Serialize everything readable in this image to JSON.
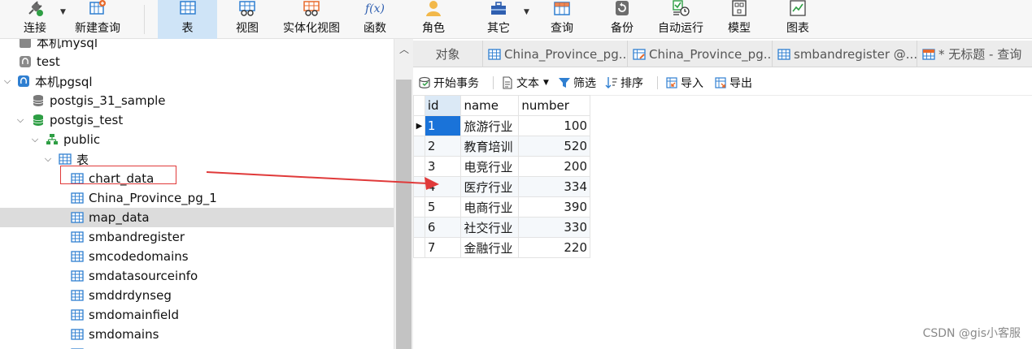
{
  "toolbar": {
    "connect": "连接",
    "new_query": "新建查询",
    "table": "表",
    "view": "视图",
    "materialized_view": "实体化视图",
    "function": "函数",
    "role": "角色",
    "other": "其它",
    "query": "查询",
    "backup": "备份",
    "automation": "自动运行",
    "model": "模型",
    "chart": "图表",
    "function_glyph": "f(x)"
  },
  "tree": {
    "partial_top": "本机mysql",
    "items": [
      {
        "label": "test"
      },
      {
        "label": "本机pgsql"
      },
      {
        "label": "postgis_31_sample"
      },
      {
        "label": "postgis_test"
      },
      {
        "label": "public"
      },
      {
        "label": "表"
      },
      {
        "label": "chart_data"
      },
      {
        "label": "China_Province_pg_1"
      },
      {
        "label": "map_data"
      },
      {
        "label": "smbandregister"
      },
      {
        "label": "smcodedomains"
      },
      {
        "label": "smdatasourceinfo"
      },
      {
        "label": "smddrdynseg"
      },
      {
        "label": "smdomainfield"
      },
      {
        "label": "smdomains"
      }
    ]
  },
  "tabs": {
    "objects": "对象",
    "tab1": "China_Province_pg...",
    "tab2": "China_Province_pg...",
    "tab3": "smbandregister @...",
    "tab4": "* 无标题 - 查询"
  },
  "subtoolbar": {
    "begin_transaction": "开始事务",
    "text": "文本",
    "filter": "筛选",
    "sort": "排序",
    "import": "导入",
    "export": "导出"
  },
  "grid": {
    "headers": [
      "id",
      "name",
      "number"
    ],
    "rows": [
      {
        "id": "1",
        "name": "旅游行业",
        "number": "100"
      },
      {
        "id": "2",
        "name": "教育培训",
        "number": "520"
      },
      {
        "id": "3",
        "name": "电竞行业",
        "number": "200"
      },
      {
        "id": "4",
        "name": "医疗行业",
        "number": "334"
      },
      {
        "id": "5",
        "name": "电商行业",
        "number": "390"
      },
      {
        "id": "6",
        "name": "社交行业",
        "number": "330"
      },
      {
        "id": "7",
        "name": "金融行业",
        "number": "220"
      }
    ],
    "selected_row": 1
  },
  "watermark": "CSDN @gis小客服",
  "colors": {
    "accent_blue": "#1a73d9",
    "active_tab_bg": "#cfe4f7",
    "annotation_red": "#e03a3a",
    "table_icon": "#2f7fd1",
    "db_green": "#2e9e44"
  }
}
